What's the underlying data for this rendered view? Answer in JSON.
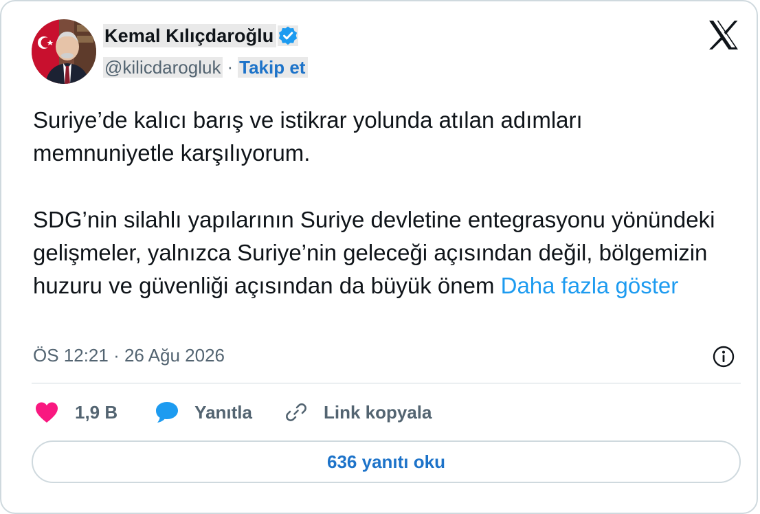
{
  "author": {
    "name": "Kemal Kılıçdaroğlu",
    "handle": "@kilicdarogluk",
    "separator": "·",
    "follow_label": "Takip et",
    "verified_icon": "verified-badge-icon",
    "avatar_icon": "profile-photo"
  },
  "platform_logo": "x-logo-icon",
  "tweet": {
    "paragraph_1": "Suriye’de kalıcı barış ve istikrar yolunda atılan adımları memnuniyetle karşılıyorum.",
    "paragraph_2": "SDG’nin silahlı yapılarının Suriye devletine entegrasyonu yönündeki gelişmeler, yalnızca Suriye’nin geleceği açısından değil, bölgemizin huzuru ve güvenliği açısından da büyük önem",
    "show_more": "Daha fazla göster"
  },
  "meta": {
    "timestamp": "ÖS 12:21 · 26 Ağu 2026",
    "info_icon": "info-icon"
  },
  "actions": {
    "like_count": "1,9 B",
    "reply_label": "Yanıtla",
    "copy_link_label": "Link kopyala"
  },
  "read_replies_label": "636 yanıtı oku",
  "colors": {
    "accent": "#1d9bf0",
    "link_dark": "#1d73c9",
    "like": "#f91880",
    "secondary_text": "#536471",
    "border": "#cfd9de"
  }
}
